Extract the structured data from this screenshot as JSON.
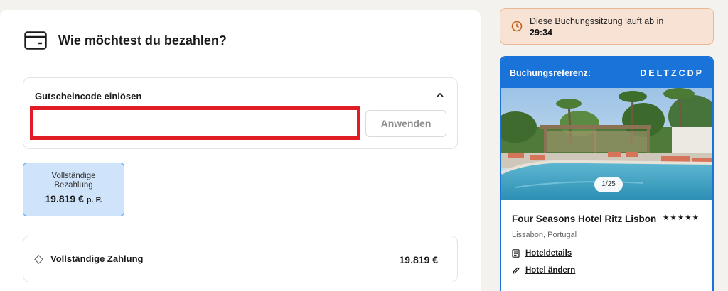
{
  "payment": {
    "title": "Wie möchtest du bezahlen?",
    "icon": "credit-card-icon"
  },
  "voucher": {
    "title": "Gutscheincode einlösen",
    "input_value": "",
    "input_placeholder": "",
    "apply_label": "Anwenden",
    "toggle_icon": "chevron-up-icon"
  },
  "payment_option": {
    "label": "Vollständige Bezahlung",
    "price": "19.819 €",
    "price_suffix": "p. P.",
    "selected": true
  },
  "summary": {
    "label": "Vollständige Zahlung",
    "amount": "19.819 €"
  },
  "session": {
    "text": "Diese Buchungssitzung läuft ab in",
    "time": "29:34",
    "icon": "clock-icon"
  },
  "booking": {
    "reference_label": "Buchungsreferenz:",
    "reference_code": "DELTZCDP",
    "photo_counter": "1/25",
    "hotel_name": "Four Seasons Hotel Ritz Lisbon",
    "stars": "★★★★★",
    "location": "Lissabon, Portugal",
    "links": [
      {
        "label": "Hoteldetails",
        "icon": "document-icon"
      },
      {
        "label": "Hotel ändern",
        "icon": "pencil-icon"
      }
    ]
  },
  "colors": {
    "accent_blue": "#1a73d8",
    "selected_bg": "#cfe4fb",
    "highlight_red": "#e01d24",
    "timer_bg": "#f7e2d3"
  }
}
